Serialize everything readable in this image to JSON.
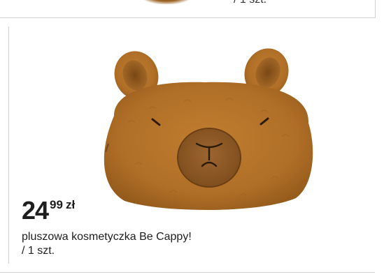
{
  "previous_card": {
    "unit_text": "/ 1 szt."
  },
  "product": {
    "image_icon": "capybara-plush-pencil-case",
    "price": {
      "integer": "24",
      "decimal": "99",
      "currency": "zł"
    },
    "name": "pluszowa kosmetyczka Be Cappy!",
    "unit": "/ 1 szt."
  },
  "colors": {
    "plush": "#b06f27",
    "plush_dark": "#8a5418",
    "snout": "#8e5a25",
    "divider": "#d2d2d2",
    "text": "#1e1e1e"
  }
}
